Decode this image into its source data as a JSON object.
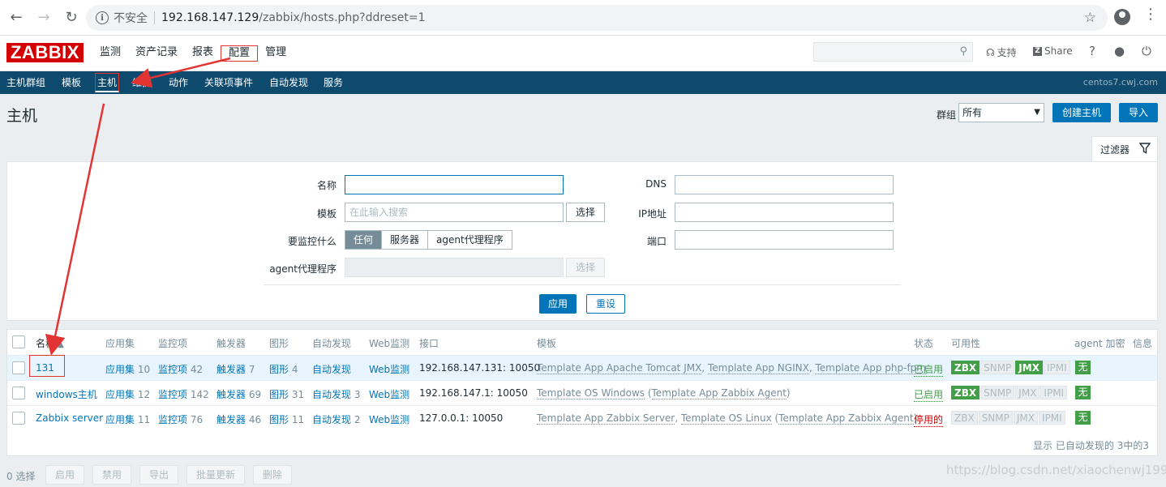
{
  "browser": {
    "insecure_label": "不安全",
    "url_host": "192.168.147.129",
    "url_path": "/zabbix/hosts.php?ddreset=1"
  },
  "header": {
    "logo": "ZABBIX",
    "menu": [
      "监测",
      "资产记录",
      "报表",
      "配置",
      "管理"
    ],
    "support": "支持",
    "share": "Share",
    "help": "?"
  },
  "submenu": {
    "items": [
      "主机群组",
      "模板",
      "主机",
      "维护",
      "动作",
      "关联项事件",
      "自动发现",
      "服务"
    ],
    "server": "centos7.cwj.com"
  },
  "page": {
    "title": "主机",
    "group_label": "群组",
    "group_value": "所有",
    "create_host": "创建主机",
    "import": "导入",
    "filter_tab": "过滤器"
  },
  "filter": {
    "name_label": "名称",
    "template_label": "模板",
    "template_placeholder": "在此输入搜索",
    "select_btn": "选择",
    "monitored_by_label": "要监控什么",
    "monitored_by": [
      "任何",
      "服务器",
      "agent代理程序"
    ],
    "proxy_label": "agent代理程序",
    "proxy_select_btn": "选择",
    "dns_label": "DNS",
    "ip_label": "IP地址",
    "port_label": "端口",
    "apply": "应用",
    "reset": "重设"
  },
  "table": {
    "columns": [
      "名称",
      "应用集",
      "监控项",
      "触发器",
      "图形",
      "自动发现",
      "Web监测",
      "接口",
      "模板",
      "状态",
      "可用性",
      "agent 加密",
      "信息"
    ],
    "rows": [
      {
        "name": "131",
        "apps_label": "应用集",
        "apps": "10",
        "items_label": "监控项",
        "items": "42",
        "triggers_label": "触发器",
        "triggers": "7",
        "graphs_label": "图形",
        "graphs": "4",
        "discovery_label": "自动发现",
        "discovery": "",
        "web": "Web监测",
        "interface": "192.168.147.131: 10050",
        "tpl1": "Template App Apache Tomcat JMX",
        "tpl2": "Template App NGINX",
        "tpl3": "Template App php-fpm",
        "tpl_parent": "",
        "status": "已启用",
        "encryption": "无"
      },
      {
        "name": "windows主机",
        "apps_label": "应用集",
        "apps": "12",
        "items_label": "监控项",
        "items": "142",
        "triggers_label": "触发器",
        "triggers": "69",
        "graphs_label": "图形",
        "graphs": "31",
        "discovery_label": "自动发现",
        "discovery": "3",
        "web": "Web监测",
        "interface": "192.168.147.1: 10050",
        "tpl1": "Template OS Windows",
        "tpl2": "",
        "tpl3": "",
        "tpl_parent": "Template App Zabbix Agent",
        "status": "已启用",
        "encryption": "无"
      },
      {
        "name": "Zabbix server",
        "apps_label": "应用集",
        "apps": "11",
        "items_label": "监控项",
        "items": "76",
        "triggers_label": "触发器",
        "triggers": "46",
        "graphs_label": "图形",
        "graphs": "11",
        "discovery_label": "自动发现",
        "discovery": "2",
        "web": "Web监测",
        "interface": "127.0.0.1: 10050",
        "tpl1": "Template App Zabbix Server",
        "tpl2": "Template OS Linux",
        "tpl3": "",
        "tpl_parent": "Template App Zabbix Agent",
        "status": "停用的",
        "encryption": "无"
      }
    ],
    "availability_labels": [
      "ZBX",
      "SNMP",
      "JMX",
      "IPMI"
    ],
    "summary": "显示 已自动发现的 3中的3"
  },
  "actions": {
    "selected": "0 选择",
    "buttons": [
      "启用",
      "禁用",
      "导出",
      "批量更新",
      "删除"
    ]
  },
  "watermark": "https://blog.csdn.net/xiaochenwj1995",
  "colors": {
    "brand_red": "#d40000",
    "primary_blue": "#0275b8",
    "submenu_bg": "#0d4a6e",
    "green": "#429e47",
    "annotation_red": "#e33434"
  }
}
